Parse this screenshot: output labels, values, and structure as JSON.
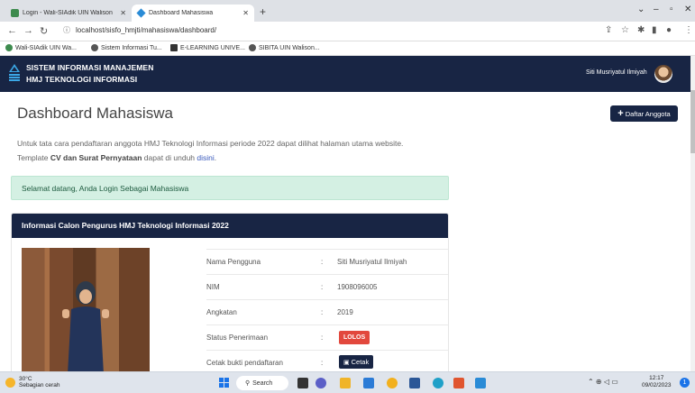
{
  "browser": {
    "tabs": [
      {
        "title": "Login - Wali-SIAdik UIN Walison",
        "active": false
      },
      {
        "title": "Dashboard Mahasiswa",
        "active": true
      }
    ],
    "url": "localhost/sisfo_hmjti/mahasiswa/dashboard/",
    "bookmarks": [
      "Wali-SIAdik UIN Wa...",
      "Sistem Informasi Tu...",
      "E-LEARNING UNIVE...",
      "SIBITA UIN Walison..."
    ]
  },
  "header": {
    "app_name_line1": "SISTEM INFORMASI MANAJEMEN",
    "app_name_line2": "HMJ TEKNOLOGI INFORMASI",
    "user_name": "Siti Musriyatul Ilmiyah"
  },
  "page": {
    "title": "Dashboard Mahasiswa",
    "add_button": "Daftar Anggota",
    "desc_line1": "Untuk tata cara pendaftaran anggota HMJ Teknologi Informasi periode 2022 dapat dilihat halaman utama website.",
    "desc_line2_a": "Template ",
    "desc_line2_b": "CV dan Surat Pernyataan",
    "desc_line2_c": " dapat di unduh ",
    "desc_line2_link": "disini",
    "desc_line2_d": ".",
    "alert": "Selamat datang, Anda Login Sebagai Mahasiswa"
  },
  "card": {
    "title": "Informasi Calon Pengurus HMJ Teknologi Informasi 2022",
    "rows": [
      {
        "label": "Nama Pengguna",
        "value": "Siti Musriyatul Ilmiyah"
      },
      {
        "label": "NIM",
        "value": "1908096005"
      },
      {
        "label": "Angkatan",
        "value": "2019"
      },
      {
        "label": "Status Penerimaan",
        "value": "LOLOS"
      },
      {
        "label": "Cetak bukti pendaftaran",
        "value": "Cetak"
      }
    ],
    "colon": ":"
  },
  "taskbar": {
    "weather_temp": "30°C",
    "weather_desc": "Sebagian cerah",
    "search": "Search",
    "time": "12:17",
    "date": "09/02/2023"
  },
  "colors": {
    "navy": "#182544",
    "alert_bg": "#d4f0e3",
    "badge_red": "#e2483d",
    "link_blue": "#3b5bbd"
  }
}
